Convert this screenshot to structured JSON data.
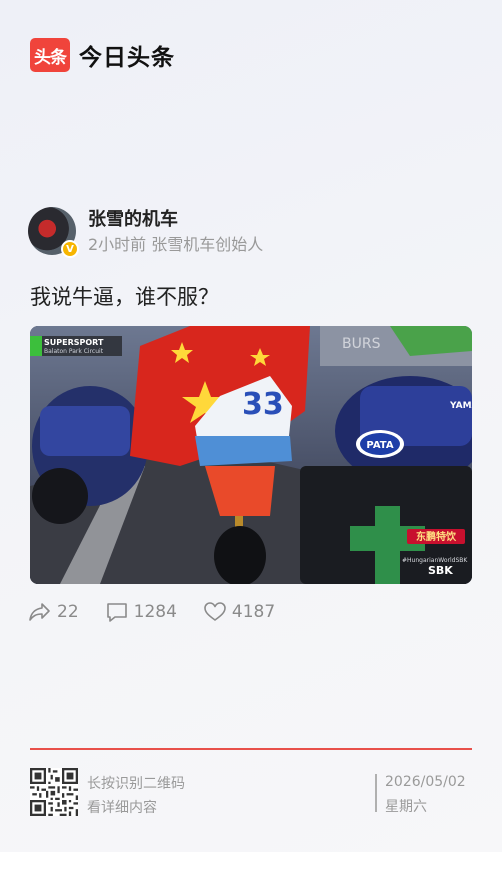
{
  "app": {
    "logo_text": "头条",
    "name": "今日头条"
  },
  "author": {
    "name": "张雪的机车",
    "meta": "2小时前 张雪机车创始人",
    "verified_mark": "V"
  },
  "post": {
    "text": "我说牛逼，谁不服？"
  },
  "media": {
    "overlay_series": "SUPERSPORT",
    "overlay_circuit": "Balaton Park Circuit",
    "bike_number": "33",
    "sponsor_pata": "PATA",
    "sponsor_east": "东鹏特饮",
    "hashtag": "#HungarianWorldSBK",
    "brand": "SBK",
    "yamaha": "YAMA"
  },
  "actions": {
    "share_count": "22",
    "comment_count": "1284",
    "like_count": "4187"
  },
  "footer": {
    "qr_line1": "长按识别二维码",
    "qr_line2": "看详细内容",
    "date": "2026/05/02",
    "weekday": "星期六"
  },
  "colors": {
    "brand_red": "#f0443b",
    "divider": "#e8504a",
    "verified": "#f7b500"
  }
}
